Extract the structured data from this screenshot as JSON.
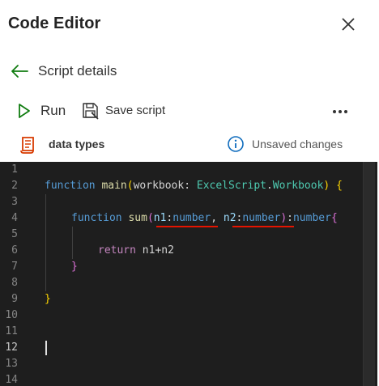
{
  "header": {
    "title": "Code Editor"
  },
  "nav": {
    "back_label": "Script details"
  },
  "toolbar": {
    "run_label": "Run",
    "save_label": "Save script"
  },
  "script": {
    "name": "data types",
    "status": "Unsaved changes"
  },
  "editor": {
    "line_numbers": [
      "1",
      "2",
      "3",
      "4",
      "5",
      "6",
      "7",
      "8",
      "9",
      "10",
      "11",
      "12",
      "13",
      "14"
    ],
    "active_line": "12",
    "lines": {
      "l2": {
        "kw": "function",
        "fn": "main",
        "open": "(",
        "param": "workbook",
        "colon": ": ",
        "type1": "ExcelScript",
        "dot": ".",
        "type2": "Workbook",
        "close": ")",
        "brace": " {"
      },
      "l4": {
        "kw": "function",
        "fn": "sum",
        "open": "(",
        "p1": "n1",
        "c1": ":",
        "t1": "number",
        "comma": ", ",
        "p2": "n2",
        "c2": ":",
        "t2": "number",
        "close": ")",
        "ret": ":number",
        "brace": "{"
      },
      "l6": {
        "kw": "return",
        "expr": " n1+n2"
      },
      "l7": {
        "brace": "}"
      },
      "l9": {
        "brace": "}"
      }
    }
  },
  "colors": {
    "editor_bg": "#1e1e1e",
    "keyword": "#569cd6",
    "function": "#dcdcaa",
    "type": "#4ec9b0",
    "error_squiggle": "#e51400",
    "accent": "#0f6cbd"
  }
}
